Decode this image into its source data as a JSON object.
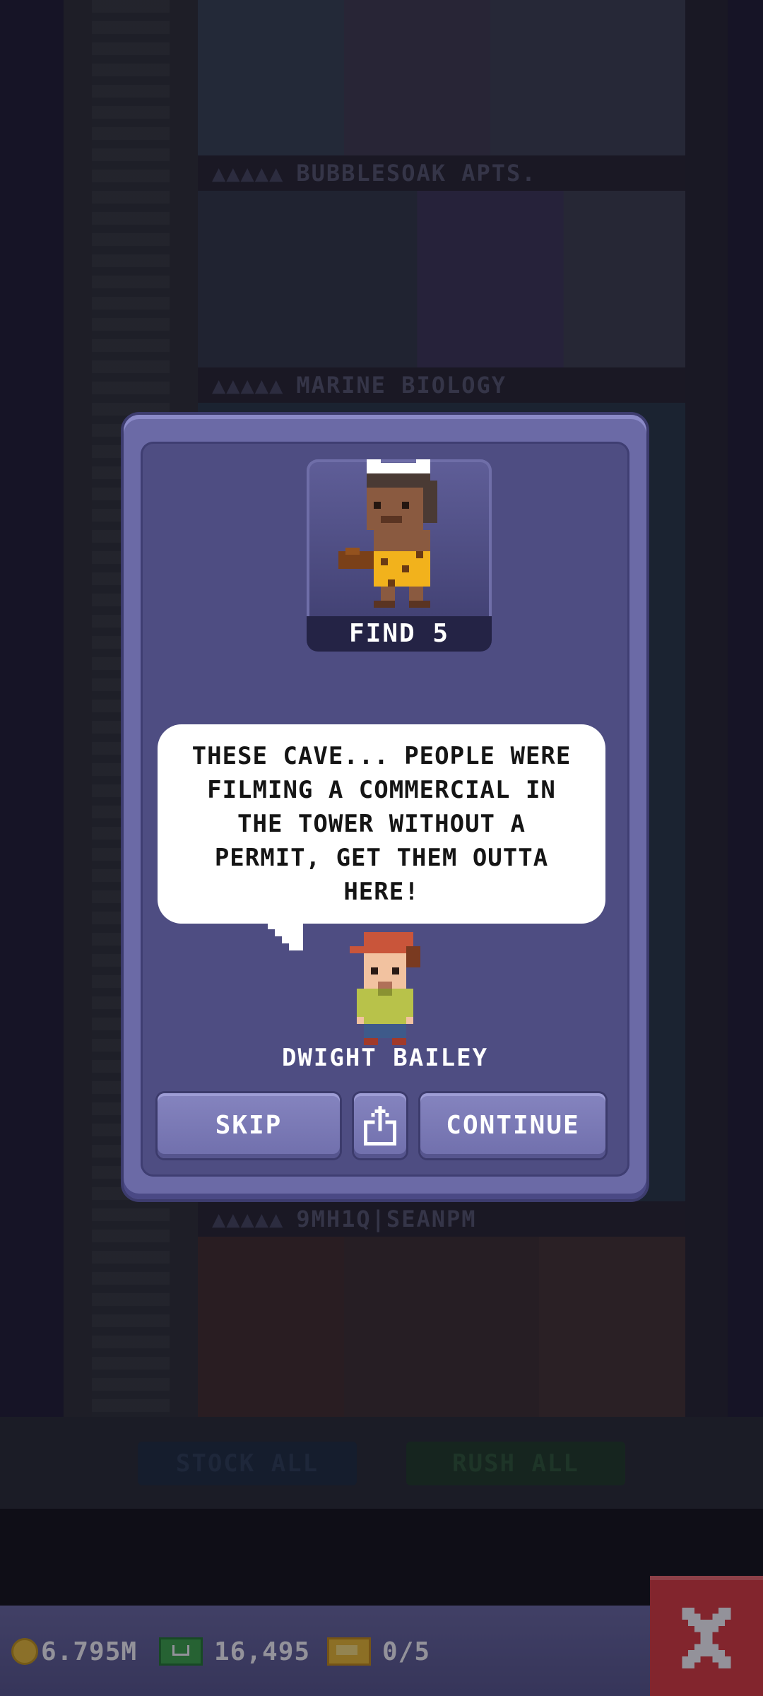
{
  "background": {
    "floors": [
      {
        "label": "BUBBLESOAK APTS.",
        "stars": "▲▲▲▲▲"
      },
      {
        "label": "MARINE BIOLOGY",
        "stars": "▲▲▲▲▲"
      },
      {
        "label": "9MH1Q|SEANPM",
        "stars": "▲▲▲▲▲"
      }
    ],
    "buttons": {
      "stock_all": "STOCK ALL",
      "rush_all": "RUSH ALL"
    }
  },
  "mission": {
    "find_label": "FIND 5",
    "message": "THESE CAVE... PEOPLE WERE FILMING A COMMERCIAL IN THE TOWER WITHOUT A PERMIT, GET THEM OUTTA HERE!",
    "npc_name": "DWIGHT BAILEY",
    "buttons": {
      "skip": "SKIP",
      "continue": "CONTINUE"
    }
  },
  "hud": {
    "coins": "6.795M",
    "bux": "16,495",
    "tickets": "0/5"
  },
  "icons": {
    "coin": "coin-icon",
    "bux": "cash-icon",
    "ticket": "ticket-icon",
    "close": "close-icon",
    "share": "share-icon"
  },
  "colors": {
    "modal": "#6b6aa6",
    "modal_inner": "#4e4d82",
    "button": "#7f7eb9",
    "hud": "#5f5f95",
    "close": "#e03a3a"
  }
}
